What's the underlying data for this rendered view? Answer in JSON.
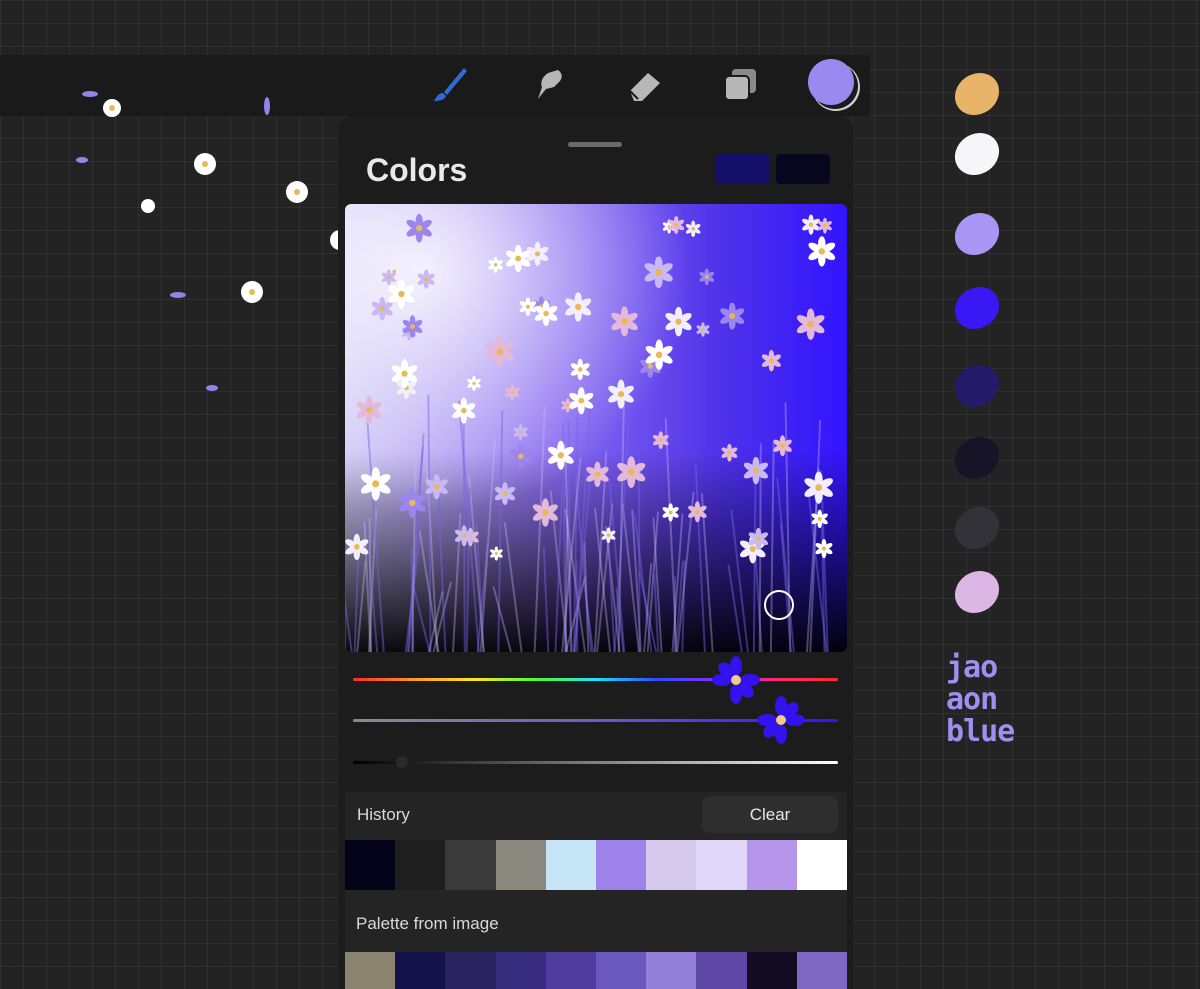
{
  "panel": {
    "title": "Colors"
  },
  "toolbar": {
    "tools": [
      {
        "name": "brush",
        "icon": "brush-icon",
        "color": "#2e6bd8"
      },
      {
        "name": "smudge",
        "icon": "smudge-icon",
        "color": "#b7b7b7"
      },
      {
        "name": "eraser",
        "icon": "eraser-icon",
        "color": "#b7b7b7"
      },
      {
        "name": "layers",
        "icon": "layers-icon",
        "color": "#b7b7b7"
      }
    ],
    "current_color": "#9a8af0"
  },
  "swatches": {
    "primary": "#14106a",
    "secondary": "#07061f"
  },
  "history": {
    "label": "History",
    "clear_label": "Clear",
    "colors": [
      "#05031a",
      "#1e1e1e",
      "#3a3a3a",
      "#8a877e",
      "#c6e6f8",
      "#9e82ea",
      "#d4c8ec",
      "#e0d6fa",
      "#b696ea",
      "#ffffff"
    ]
  },
  "palette": {
    "label": "Palette from image",
    "colors": [
      "#8c8270",
      "#15124a",
      "#28225e",
      "#372c7e",
      "#4f3c9e",
      "#6a5ac0",
      "#9280d8",
      "#5e46a4",
      "#120c22",
      "#7e68c4"
    ]
  },
  "reference_strokes": [
    "#e8b46a",
    "#f6f6f8",
    "#a796f4",
    "#3a18f6",
    "#241a6a",
    "#161426",
    "#333238",
    "#dcb6e4"
  ],
  "signature": [
    "jao",
    "aon",
    "blue"
  ]
}
